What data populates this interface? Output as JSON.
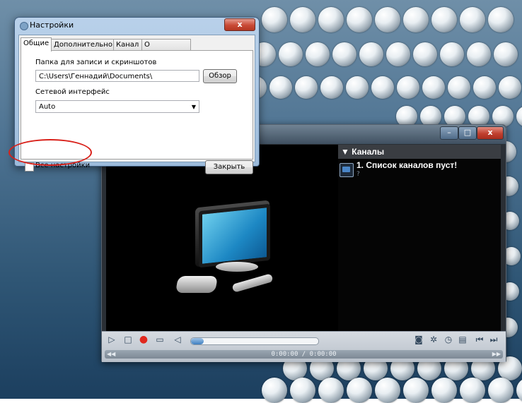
{
  "dialog": {
    "title": "Настройки",
    "close_glyph": "x",
    "tabs": [
      {
        "label": "Общие",
        "active": true
      },
      {
        "label": "Дополнительно",
        "active": false
      },
      {
        "label": "Канал",
        "active": false
      },
      {
        "label": "О программе",
        "active": false
      }
    ],
    "folder_label": "Папка для записи и скриншотов",
    "folder_value": "C:\\Users\\Геннадий\\Documents\\",
    "browse_label": "Обзор",
    "network_label": "Сетевой интерфейс",
    "network_value": "Auto",
    "all_settings_label": "Все настройки",
    "all_settings_checked": false,
    "close_label": "Закрыть",
    "highlight_color": "#d9211a"
  },
  "player": {
    "window_controls": {
      "minimize": "–",
      "maximize": "□",
      "close": "x"
    },
    "channels_header": "Каналы",
    "channels_list": [
      {
        "title": "1. Список каналов пуст!",
        "sub": "?"
      }
    ],
    "controls": {
      "play_icon": "play-icon",
      "stop_icon": "stop-icon",
      "record_icon": "record-icon",
      "open_icon": "folder-icon",
      "volume_icon": "speaker-icon",
      "volume_level": 0.1
    },
    "time_display": "0:00:00 / 0:00:00",
    "seek_left_glyph": "◀◀",
    "seek_right_glyph": "▶▶"
  }
}
